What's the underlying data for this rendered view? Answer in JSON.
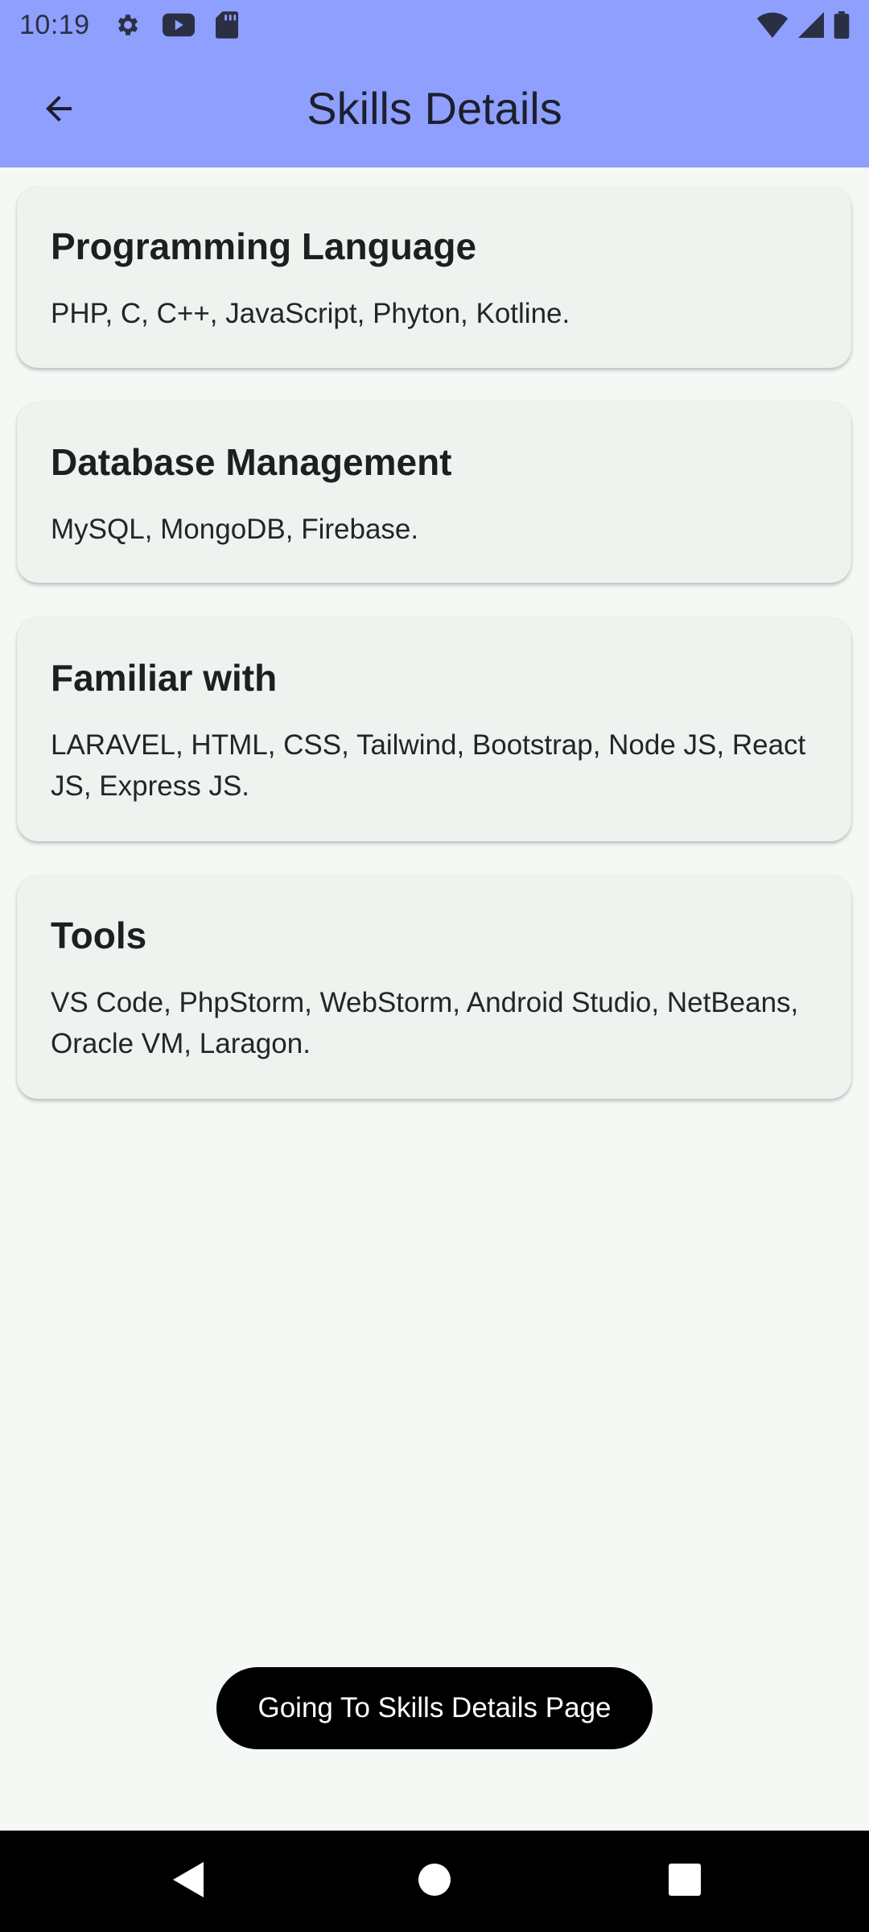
{
  "status_bar": {
    "time": "10:19",
    "icons": [
      "settings-icon",
      "youtube-icon",
      "sd-card-icon"
    ],
    "right_icons": [
      "wifi-icon",
      "cell-signal-icon",
      "battery-icon"
    ]
  },
  "app_bar": {
    "title": "Skills Details",
    "back_icon": "arrow-back-icon",
    "color": "#8f9ffd"
  },
  "cards": [
    {
      "title": "Programming Language",
      "body": "PHP, C, C++, JavaScript, Phyton, Kotline."
    },
    {
      "title": "Database Management",
      "body": "MySQL, MongoDB, Firebase."
    },
    {
      "title": "Familiar with",
      "body": "LARAVEL, HTML, CSS, Tailwind, Bootstrap, Node JS, React JS, Express JS."
    },
    {
      "title": "Tools",
      "body": "VS Code, PhpStorm, WebStorm, Android Studio, NetBeans, Oracle VM, Laragon."
    }
  ],
  "toast": {
    "text": "Going To Skills Details Page"
  },
  "nav_bar": {
    "buttons": [
      "back-triangle-icon",
      "home-circle-icon",
      "recents-square-icon"
    ]
  }
}
